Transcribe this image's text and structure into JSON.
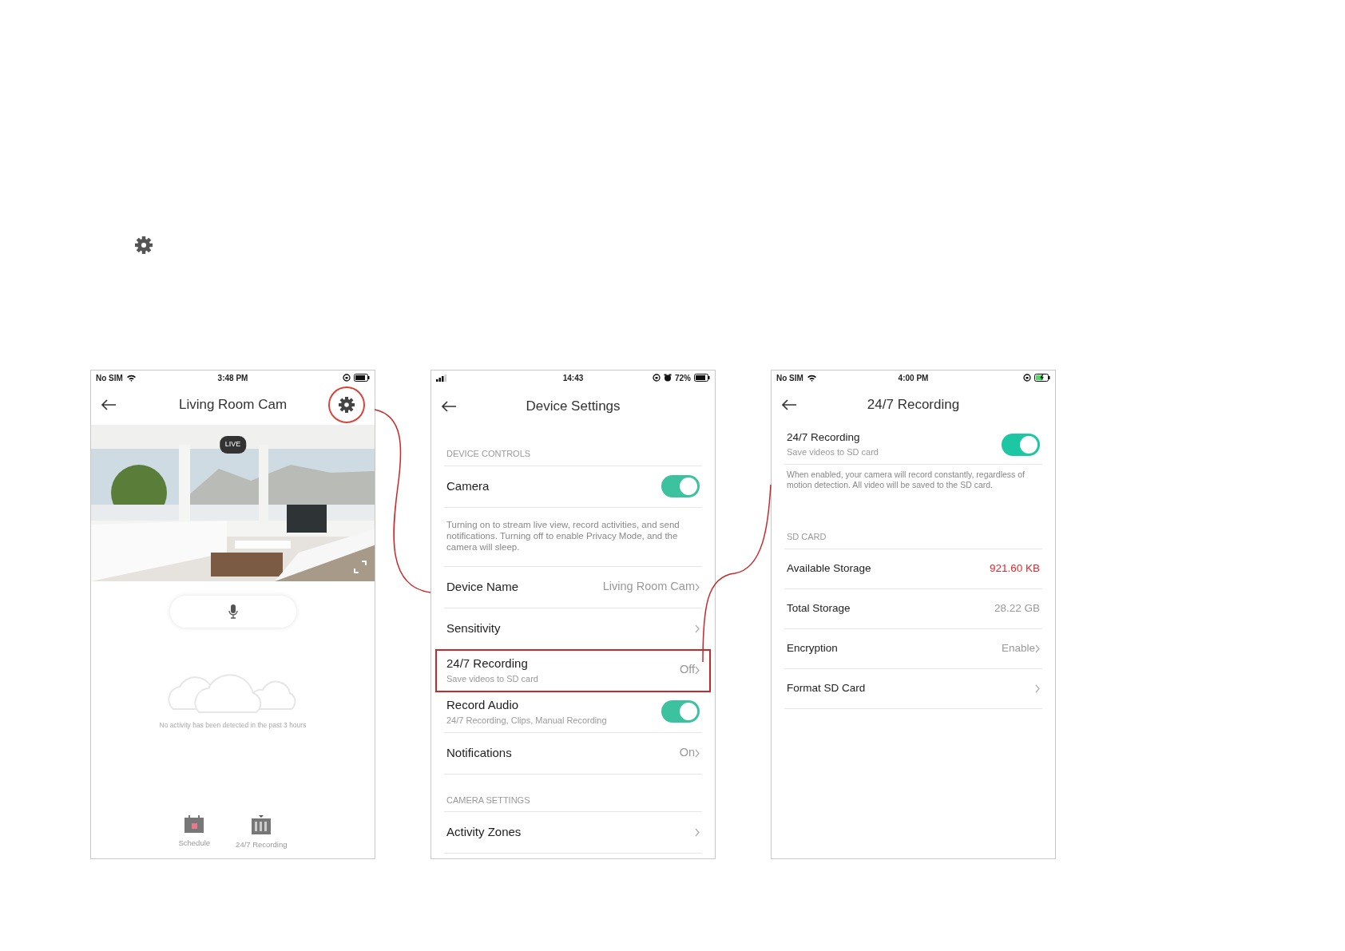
{
  "screens": [
    {
      "kind": "live",
      "status_bar": {
        "carrier": "No SIM",
        "time": "3:48 PM",
        "charging": false
      },
      "title": "Living Room Cam",
      "settings_highlighted": true,
      "live_badge": "LIVE",
      "empty_message": "No activity has been detected in the past 3 hours",
      "bottom_tabs": [
        {
          "kind": "schedule",
          "label": "Schedule"
        },
        {
          "kind": "recording",
          "label": "24/7 Recording"
        }
      ]
    },
    {
      "kind": "settings",
      "status_bar": {
        "time": "14:43",
        "battery": "72%",
        "alarm": true,
        "charging": false
      },
      "title": "Device Settings",
      "sections": [
        {
          "heading": "DEVICE CONTROLS",
          "rows": [
            {
              "kind": "toggle",
              "label": "Camera",
              "on": true,
              "highlighted": false
            },
            {
              "kind": "note",
              "text": "Turning on to stream live view, record activities, and send notifications. Turning off to enable Privacy Mode, and the camera will sleep."
            },
            {
              "kind": "link",
              "label": "Device Name",
              "value": "Living Room Cam",
              "highlighted": false
            },
            {
              "kind": "link",
              "label": "Sensitivity",
              "highlighted": false
            },
            {
              "kind": "link",
              "label": "24/7 Recording",
              "subtitle": "Save videos to SD card",
              "value": "Off",
              "highlighted": true
            },
            {
              "kind": "toggle",
              "label": "Record Audio",
              "subtitle": "24/7 Recording, Clips, Manual Recording",
              "on": true,
              "highlighted": false
            },
            {
              "kind": "link",
              "label": "Notifications",
              "value": "On",
              "highlighted": false
            }
          ]
        },
        {
          "heading": "CAMERA SETTINGS",
          "rows": [
            {
              "kind": "link",
              "label": "Activity Zones",
              "highlighted": false
            }
          ]
        }
      ]
    },
    {
      "kind": "settings",
      "status_bar": {
        "carrier": "No SIM",
        "time": "4:00 PM",
        "charging": true
      },
      "title": "24/7 Recording",
      "sections": [
        {
          "rows": [
            {
              "kind": "toggle",
              "label": "24/7 Recording",
              "subtitle": "Save videos to SD card",
              "on": true,
              "highlighted": false
            },
            {
              "kind": "note",
              "text": "When enabled, your camera will record constantly, regardless of motion detection. All video will be saved to the SD card."
            }
          ]
        },
        {
          "heading": "SD CARD",
          "rows": [
            {
              "kind": "value",
              "label": "Available Storage",
              "value": "921.60 KB",
              "warning": true,
              "highlighted": false
            },
            {
              "kind": "value",
              "label": "Total Storage",
              "value": "28.22 GB",
              "warning": false,
              "highlighted": false
            },
            {
              "kind": "link",
              "label": "Encryption",
              "value": "Enable",
              "highlighted": false
            },
            {
              "kind": "link",
              "label": "Format SD Card",
              "highlighted": false
            }
          ]
        }
      ]
    }
  ]
}
